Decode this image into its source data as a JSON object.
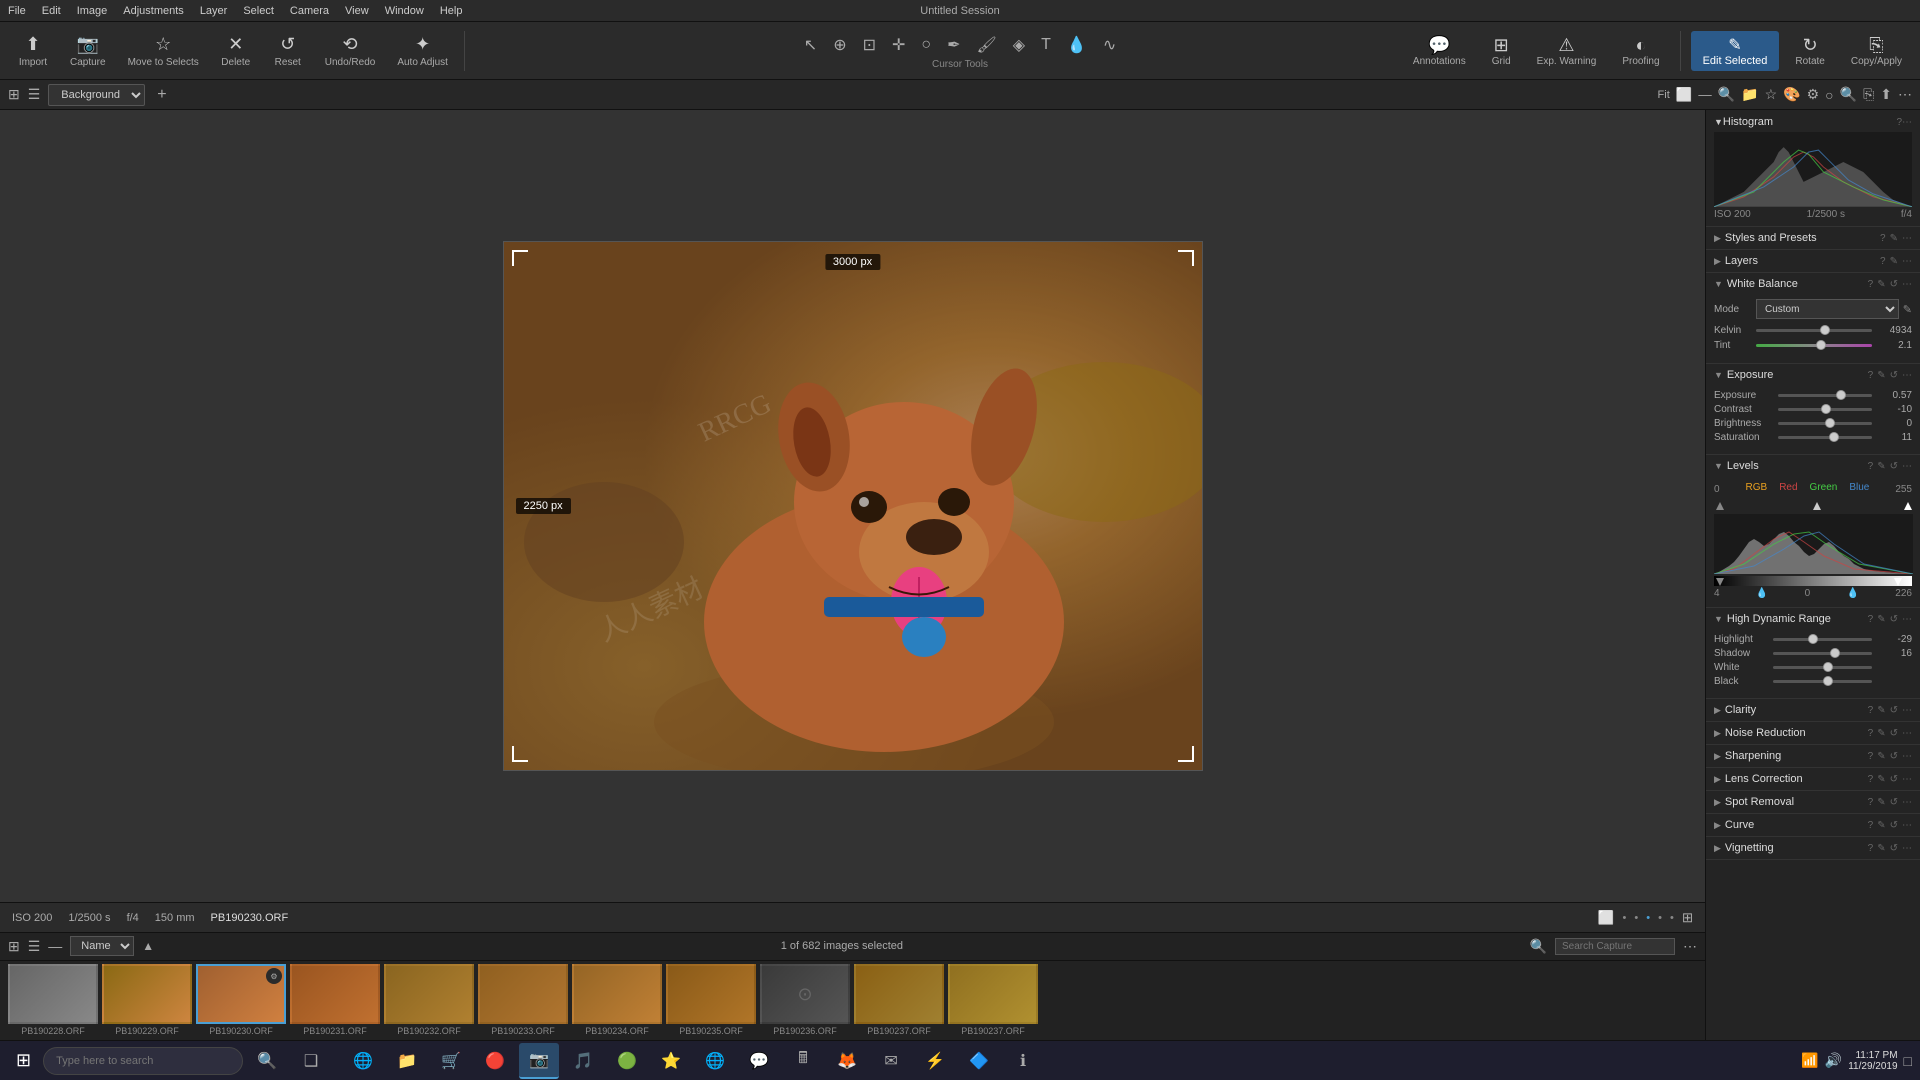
{
  "window": {
    "title": "Untitled Session"
  },
  "menu": {
    "items": [
      "File",
      "Edit",
      "Image",
      "Adjustments",
      "Layer",
      "Select",
      "Camera",
      "View",
      "Window",
      "Help"
    ]
  },
  "toolbar": {
    "import_label": "Import",
    "capture_label": "Capture",
    "move_to_selects_label": "Move to Selects",
    "delete_label": "Delete",
    "reset_label": "Reset",
    "undo_redo_label": "Undo/Redo",
    "auto_adjust_label": "Auto Adjust",
    "cursor_tools_label": "Cursor Tools",
    "annotations_label": "Annotations",
    "grid_label": "Grid",
    "exp_warning_label": "Exp. Warning",
    "proofing_label": "Proofing",
    "edit_selected_label": "Edit Selected",
    "rotate_label": "Rotate",
    "copy_apply_label": "Copy/Apply"
  },
  "secondary_toolbar": {
    "layer_name": "Background",
    "fit_label": "Fit"
  },
  "canvas": {
    "size_top": "3000 px",
    "size_left": "2250 px"
  },
  "status_bar": {
    "iso": "ISO 200",
    "shutter": "1/2500 s",
    "aperture": "f/4",
    "focal": "150 mm",
    "filename": "PB190230.ORF"
  },
  "filmstrip": {
    "count_label": "1 of 682 images selected",
    "sort_label": "Name",
    "search_placeholder": "Search Capture",
    "thumbnails": [
      {
        "label": "PB190228.ORF",
        "selected": false
      },
      {
        "label": "PB190229.ORF",
        "selected": false
      },
      {
        "label": "PB190230.ORF",
        "selected": true
      },
      {
        "label": "PB190231.ORF",
        "selected": false
      },
      {
        "label": "PB190232.ORF",
        "selected": false
      },
      {
        "label": "PB190233.ORF",
        "selected": false
      },
      {
        "label": "PB190234.ORF",
        "selected": false
      },
      {
        "label": "PB190235.ORF",
        "selected": false
      },
      {
        "label": "PB190236.ORF",
        "selected": false
      },
      {
        "label": "PB190237.ORF",
        "selected": false
      }
    ]
  },
  "right_panel": {
    "histogram": {
      "title": "Histogram",
      "iso": "ISO 200",
      "shutter": "1/2500 s",
      "aperture": "f/4"
    },
    "styles_presets": {
      "title": "Styles and Presets"
    },
    "layers": {
      "title": "Layers"
    },
    "white_balance": {
      "title": "White Balance",
      "mode_label": "Mode",
      "mode_value": "Custom",
      "kelvin_label": "Kelvin",
      "kelvin_value": "4934",
      "tint_label": "Tint",
      "tint_value": "2.1"
    },
    "exposure": {
      "title": "Exposure",
      "exposure_label": "Exposure",
      "exposure_value": "0.57",
      "contrast_label": "Contrast",
      "contrast_value": "-10",
      "brightness_label": "Brightness",
      "brightness_value": "0",
      "saturation_label": "Saturation",
      "saturation_value": "11"
    },
    "levels": {
      "title": "Levels",
      "tab_rgb": "RGB",
      "tab_red": "Red",
      "tab_green": "Green",
      "tab_blue": "Blue",
      "min": "0",
      "max": "255",
      "input_black": "4",
      "input_mid": "0",
      "output_black": "0",
      "output_white": "226"
    },
    "hdr": {
      "title": "High Dynamic Range",
      "highlight_label": "Highlight",
      "highlight_value": "-29",
      "shadow_label": "Shadow",
      "shadow_value": "16",
      "white_label": "White",
      "white_value": "",
      "black_label": "Black",
      "black_value": ""
    },
    "clarity": {
      "title": "Clarity"
    },
    "noise_reduction": {
      "title": "Noise Reduction"
    },
    "sharpening": {
      "title": "Sharpening"
    },
    "lens_correction": {
      "title": "Lens Correction"
    },
    "spot_removal": {
      "title": "Spot Removal"
    },
    "curve": {
      "title": "Curve"
    },
    "vignetting": {
      "title": "Vignetting"
    }
  },
  "taskbar": {
    "search_placeholder": "Type here to search",
    "time": "11:17 PM",
    "date": "11/29/2019",
    "taskbar_icons": [
      "⊞",
      "🔍",
      "❑",
      "✉",
      "🌐",
      "📁",
      "🛒",
      "🔴",
      "🎵",
      "🟢",
      "🟡"
    ]
  }
}
